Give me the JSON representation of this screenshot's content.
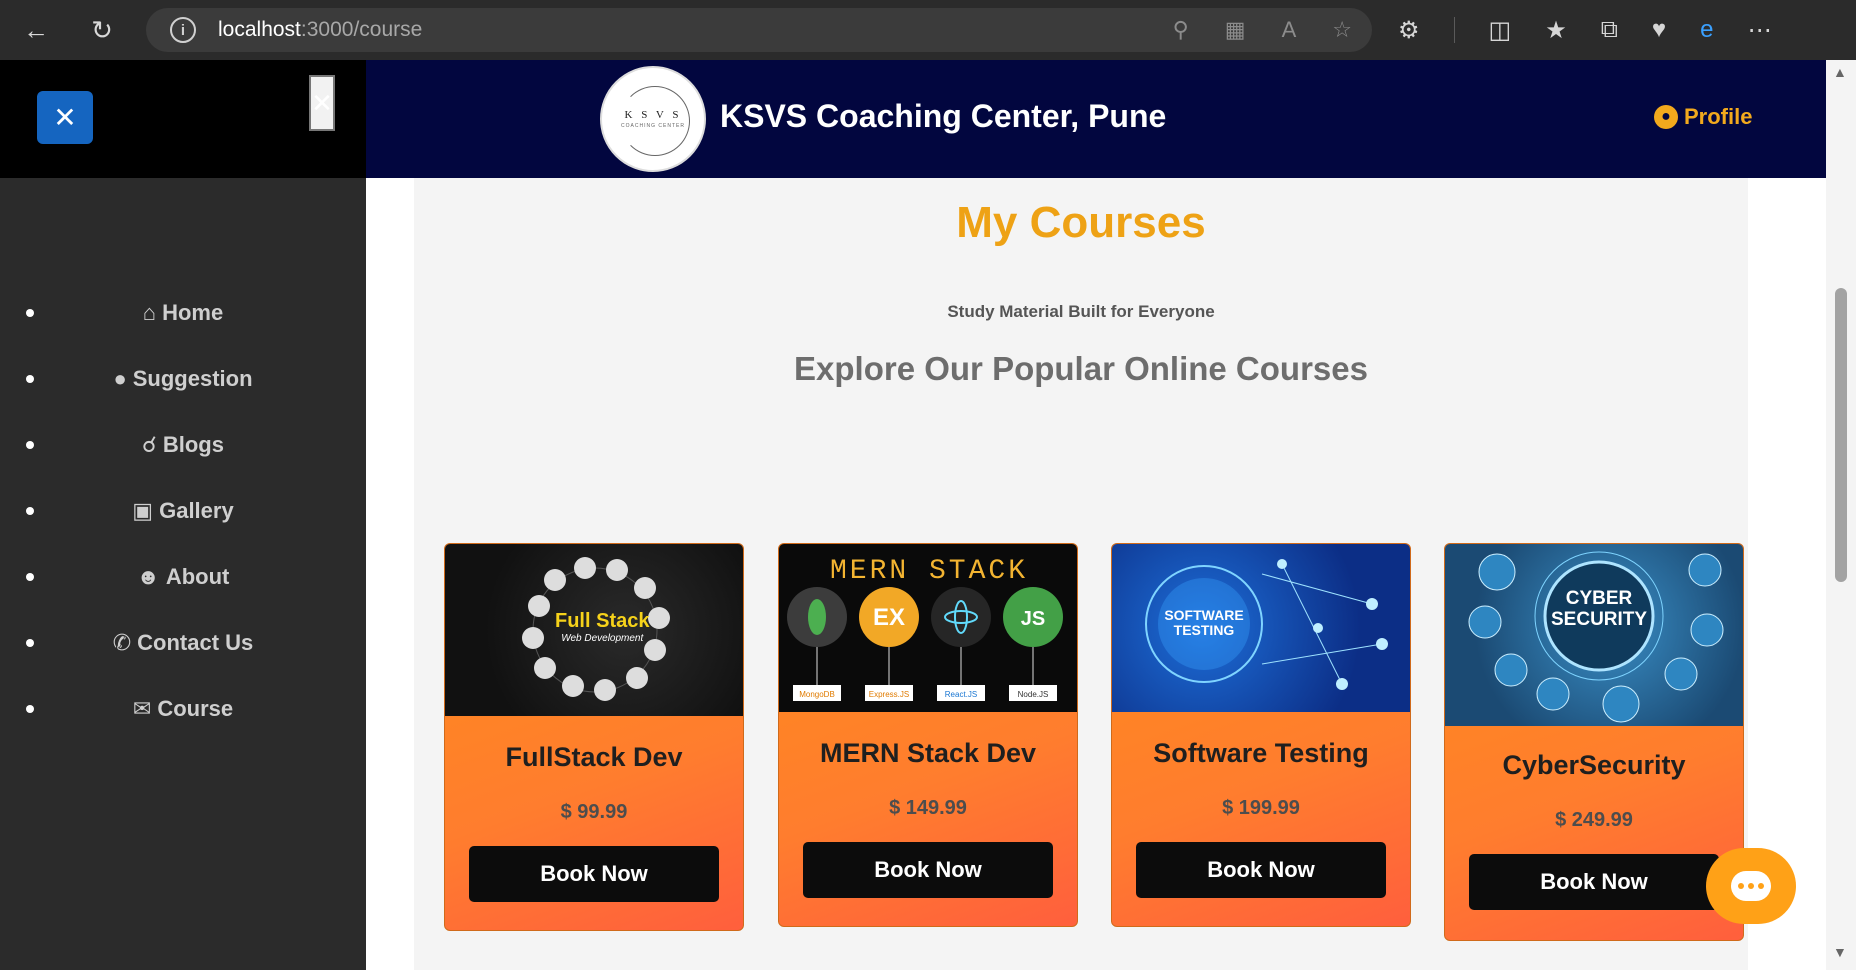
{
  "browser": {
    "url_host": "localhost",
    "url_path": ":3000/course"
  },
  "sidebar": {
    "close_label": "✕",
    "items": [
      {
        "label": "Home",
        "icon": "home-icon"
      },
      {
        "label": "Suggestion",
        "icon": "lightbulb-icon"
      },
      {
        "label": "Blogs",
        "icon": "blog-icon"
      },
      {
        "label": "Gallery",
        "icon": "gallery-icon"
      },
      {
        "label": "About",
        "icon": "user-icon"
      },
      {
        "label": "Contact Us",
        "icon": "phone-icon"
      },
      {
        "label": "Course",
        "icon": "envelope-icon"
      }
    ]
  },
  "header": {
    "logo_text": "K S V S",
    "logo_sub": "COACHING CENTER",
    "title": "KSVS Coaching Center, Pune",
    "profile_label": "Profile"
  },
  "main": {
    "title": "My Courses",
    "tagline": "Study Material Built for Everyone",
    "heading": "Explore Our Popular Online Courses",
    "courses": [
      {
        "title": "FullStack Dev",
        "price": "$ 99.99",
        "button": "Book Now",
        "image_text": "Full Stack",
        "image_sub": "Web Development"
      },
      {
        "title": "MERN Stack Dev",
        "price": "$ 149.99",
        "button": "Book Now",
        "image_text": "MERN STACK",
        "image_labels": [
          "MongoDB",
          "Express.JS",
          "React.JS",
          "Node.JS"
        ],
        "image_icons": [
          "EX",
          "JS"
        ]
      },
      {
        "title": "Software Testing",
        "price": "$ 199.99",
        "button": "Book Now",
        "image_text": "SOFTWARE TESTING"
      },
      {
        "title": "CyberSecurity",
        "price": "$ 249.99",
        "button": "Book Now",
        "image_text": "CYBER SECURITY"
      }
    ]
  },
  "colors": {
    "header_bg": "#02063f",
    "accent_orange": "#eea215",
    "card_orange": "#ff7d2e",
    "close_blue": "#1565c0"
  }
}
